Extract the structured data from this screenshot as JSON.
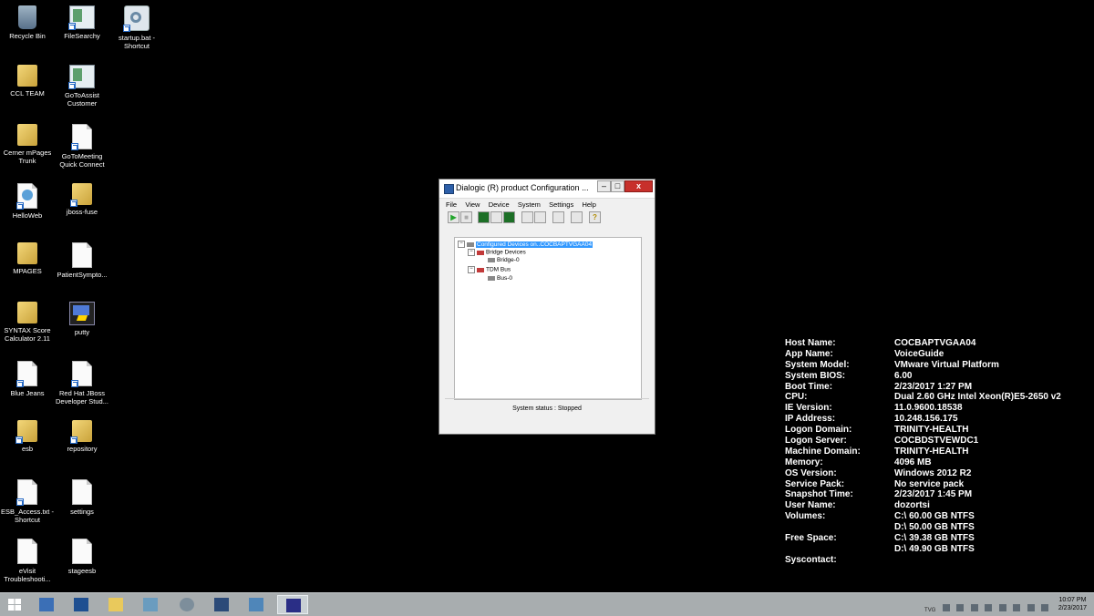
{
  "desktop_icons": [
    {
      "label": "Recycle Bin",
      "icon": "recycle-bin-icon"
    },
    {
      "label": "FileSearchy",
      "icon": "app-icon"
    },
    {
      "label": "startup.bat - Shortcut",
      "icon": "gear-icon"
    },
    {
      "label": "CCL TEAM",
      "icon": "folder-icon"
    },
    {
      "label": "GoToAssist Customer",
      "icon": "app-icon"
    },
    {
      "label": "Cerner mPages Trunk",
      "icon": "folder-icon"
    },
    {
      "label": "GoToMeeting Quick Connect",
      "icon": "file-icon"
    },
    {
      "label": "HelloWeb",
      "icon": "file-icon"
    },
    {
      "label": "jboss-fuse",
      "icon": "folder-icon"
    },
    {
      "label": "MPAGES",
      "icon": "folder-icon"
    },
    {
      "label": "PatientSympto...",
      "icon": "file-icon"
    },
    {
      "label": "SYNTAX Score Calculator 2.11",
      "icon": "folder-icon"
    },
    {
      "label": "putty",
      "icon": "putty-icon"
    },
    {
      "label": "Blue Jeans",
      "icon": "file-icon"
    },
    {
      "label": "Red Hat JBoss Developer Stud...",
      "icon": "file-icon"
    },
    {
      "label": "esb",
      "icon": "folder-icon"
    },
    {
      "label": "repository",
      "icon": "folder-icon"
    },
    {
      "label": "ESB_Access.txt - Shortcut",
      "icon": "file-icon"
    },
    {
      "label": "settings",
      "icon": "file-icon"
    },
    {
      "label": "eVisit Troubleshooti...",
      "icon": "file-icon"
    },
    {
      "label": "stageesb",
      "icon": "file-icon"
    }
  ],
  "window": {
    "title": "Dialogic (R) product Configuration ...",
    "controls": {
      "minimize": "–",
      "maximize": "□",
      "close": "x"
    },
    "menu": [
      "File",
      "View",
      "Device",
      "System",
      "Settings",
      "Help"
    ],
    "toolbar_glyphs": {
      "play": "▶",
      "stop": "■",
      "help": "?"
    },
    "tree": {
      "root": "Configured Devices on..COCBAPTVGAA04",
      "bridge_group": "Bridge Devices",
      "bridge_item": "Bridge-0",
      "tdm_group": "TDM Bus",
      "tdm_item": "Bus-0",
      "expand_glyph": "−"
    },
    "status": "System status :  Stopped"
  },
  "sysinfo": [
    {
      "label": "Host Name:",
      "value": "COCBAPTVGAA04"
    },
    {
      "label": "App Name:",
      "value": "VoiceGuide"
    },
    {
      "label": "System Model:",
      "value": "VMware Virtual Platform"
    },
    {
      "label": "System BIOS:",
      "value": "6.00"
    },
    {
      "label": "Boot Time:",
      "value": "2/23/2017 1:27 PM"
    },
    {
      "label": "CPU:",
      "value": "Dual 2.60 GHz Intel Xeon(R)E5-2650 v2"
    },
    {
      "label": "IE Version:",
      "value": "11.0.9600.18538"
    },
    {
      "label": "IP Address:",
      "value": "10.248.156.175"
    },
    {
      "label": "Logon Domain:",
      "value": "TRINITY-HEALTH"
    },
    {
      "label": "Logon Server:",
      "value": "COCBDSTVEWDC1"
    },
    {
      "label": "Machine Domain:",
      "value": "TRINITY-HEALTH"
    },
    {
      "label": "Memory:",
      "value": "4096 MB"
    },
    {
      "label": "OS Version:",
      "value": "Windows 2012 R2"
    },
    {
      "label": "Service Pack:",
      "value": "No service pack"
    },
    {
      "label": "Snapshot Time:",
      "value": "2/23/2017 1:45 PM"
    },
    {
      "label": "User Name:",
      "value": "dozortsi"
    },
    {
      "label": "Volumes:",
      "value": "C:\\ 60.00 GB NTFS"
    },
    {
      "label": "",
      "value": "D:\\ 50.00 GB NTFS"
    },
    {
      "label": "Free Space:",
      "value": "C:\\ 39.38 GB NTFS"
    },
    {
      "label": "",
      "value": "D:\\ 49.90 GB NTFS"
    },
    {
      "label": "Syscontact:",
      "value": ""
    }
  ],
  "taskbar": {
    "items": [
      {
        "icon": "windows-start-icon"
      },
      {
        "icon": "server-manager-icon"
      },
      {
        "icon": "powershell-icon"
      },
      {
        "icon": "file-explorer-icon"
      },
      {
        "icon": "app-icon"
      },
      {
        "icon": "gear-icon"
      },
      {
        "icon": "network-icon"
      },
      {
        "icon": "remote-desktop-icon"
      },
      {
        "icon": "dialogic-app-icon"
      }
    ],
    "tray": {
      "label": "TVG"
    },
    "clock": {
      "time": "10:07 PM",
      "date": "2/23/2017"
    }
  }
}
